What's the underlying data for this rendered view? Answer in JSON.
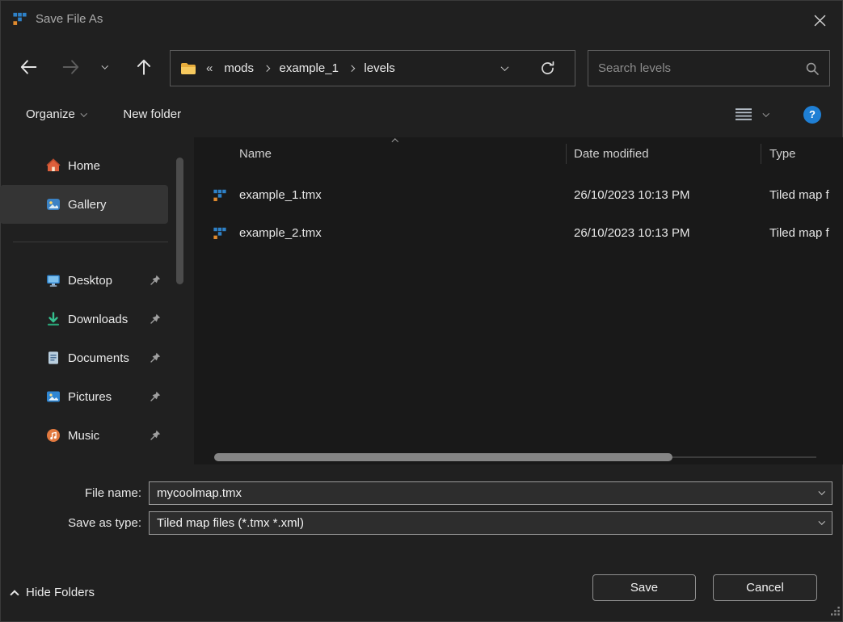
{
  "window": {
    "title": "Save File As"
  },
  "nav": {
    "breadcrumb": {
      "overflow": "«",
      "segments": [
        "mods",
        "example_1",
        "levels"
      ]
    },
    "search_placeholder": "Search levels"
  },
  "toolbar": {
    "organize": "Organize",
    "new_folder": "New folder",
    "help_glyph": "?"
  },
  "sidebar": {
    "items": [
      {
        "label": "Home"
      },
      {
        "label": "Gallery"
      },
      {
        "label": "Desktop"
      },
      {
        "label": "Downloads"
      },
      {
        "label": "Documents"
      },
      {
        "label": "Pictures"
      },
      {
        "label": "Music"
      }
    ]
  },
  "file_list": {
    "columns": {
      "name": "Name",
      "date_modified": "Date modified",
      "type": "Type"
    },
    "rows": [
      {
        "name": "example_1.tmx",
        "date_modified": "26/10/2023 10:13 PM",
        "type": "Tiled map f"
      },
      {
        "name": "example_2.tmx",
        "date_modified": "26/10/2023 10:13 PM",
        "type": "Tiled map f"
      }
    ]
  },
  "form": {
    "file_name_label": "File name:",
    "file_name_value": "mycoolmap.tmx",
    "save_as_type_label": "Save as type:",
    "save_as_type_value": "Tiled map files (*.tmx *.xml)"
  },
  "footer": {
    "hide_folders": "Hide Folders",
    "save": "Save",
    "cancel": "Cancel"
  },
  "colors": {
    "accent_blue": "#1f7fd4",
    "folder_yellow": "#f6c24e",
    "tiled_blue": "#2e81c8",
    "tiled_orange": "#e08a2e",
    "selection_gray": "#343434"
  }
}
